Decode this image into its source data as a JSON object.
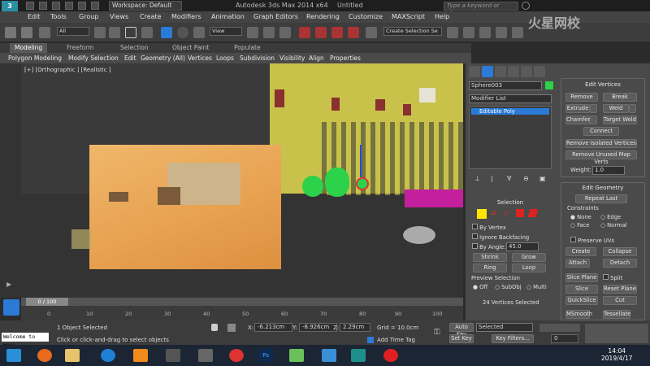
{
  "titlebar": {
    "workspace": "Workspace: Default",
    "title": "Autodesk 3ds Max  2014 x64",
    "document": "Untitled",
    "search_placeholder": "Type a keyword or phrase"
  },
  "menubar": [
    "Edit",
    "Tools",
    "Group",
    "Views",
    "Create",
    "Modifiers",
    "Animation",
    "Graph Editors",
    "Rendering",
    "Customize",
    "MAXScript",
    "Help"
  ],
  "toolbar": {
    "selection_filter": "All",
    "ref_coord": "View",
    "selection_set": "Create Selection Se"
  },
  "ribbon": {
    "tabs": [
      "Modeling",
      "Freeform",
      "Selection",
      "Object Paint",
      "Populate"
    ],
    "commands": [
      "Polygon Modeling",
      "Modify Selection",
      "Edit",
      "Geometry (All)",
      "Vertices",
      "Loops",
      "Subdivision",
      "Visibility",
      "Align",
      "Properties"
    ]
  },
  "viewport": {
    "label": "[+] [Orthographic ] [Realistic ]"
  },
  "timeline": {
    "frame": "0 / 100",
    "ticks": [
      "0",
      "10",
      "20",
      "30",
      "40",
      "50",
      "60",
      "70",
      "80",
      "90",
      "100"
    ]
  },
  "command_panel": {
    "object_name": "Sphere003",
    "modifier_list": "Modifier List",
    "stack_item": "Editable Poly",
    "edit_vertices": {
      "title": "Edit Vertices",
      "remove": "Remove",
      "break": "Break",
      "extrude": "Extrude",
      "weld": "Weld",
      "chamfer": "Chamfer",
      "target_weld": "Target Weld",
      "connect": "Connect",
      "remove_isolated": "Remove Isolated Vertices",
      "remove_unused": "Remove Unused Map Verts",
      "weight_label": "Weight:",
      "weight_value": "1.0"
    },
    "edit_geometry": {
      "title": "Edit Geometry",
      "repeat_last": "Repeat Last",
      "constraints": "Constraints",
      "none": "None",
      "edge": "Edge",
      "face": "Face",
      "normal": "Normal",
      "preserve_uvs": "Preserve UVs",
      "create": "Create",
      "collapse": "Collapse",
      "attach": "Attach",
      "detach": "Detach",
      "slice_plane": "Slice Plane",
      "split": "Split",
      "slice": "Slice",
      "reset_plane": "Reset Plane",
      "quickslice": "QuickSlice",
      "cut": "Cut",
      "msmooth": "MSmooth",
      "tessellate": "Tessellate"
    },
    "selection": {
      "title": "Selection",
      "by_vertex": "By Vertex",
      "ignore_backfacing": "Ignore Backfacing",
      "by_angle": "By Angle:",
      "angle_value": "45.0",
      "shrink": "Shrink",
      "grow": "Grow",
      "ring": "Ring",
      "loop": "Loop",
      "preview": "Preview Selection",
      "off": "Off",
      "subobj": "SubObj",
      "multi": "Multi",
      "status": "24 Vertices Selected"
    }
  },
  "status": {
    "maxscript": "Welcome to MAX!",
    "selected": "1 Object Selected",
    "prompt": "Click or click-and-drag to select objects",
    "x_label": "X:",
    "x": "-6.213cm",
    "y_label": "Y:",
    "y": "-8.926cm",
    "z_label": "Z:",
    "z": "2.29cm",
    "grid": "Grid = 10.0cm",
    "add_time_tag": "Add Time Tag",
    "auto_key": "Auto Key",
    "auto_key_value": "Selected",
    "set_key": "Set Key",
    "key_filters": "Key Filters...",
    "frame_field": "0"
  },
  "taskbar": {
    "time": "14:04",
    "date": "2019/4/17"
  },
  "watermark": "火星网校",
  "colors": {
    "accent_blue": "#2a7ad6",
    "wall_yellow": "#c9c24a",
    "vertex_green": "#2bd24a",
    "magenta": "#c41f9c"
  }
}
